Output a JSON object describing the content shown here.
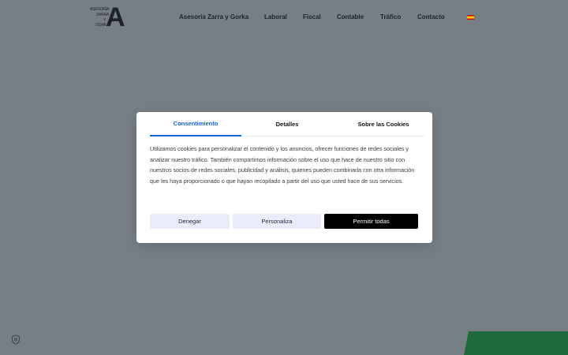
{
  "logo": {
    "small_lines": [
      "ASESORÍA",
      "ZARRA",
      "Y",
      "GORKA"
    ],
    "big_letter": "A"
  },
  "nav": {
    "items": [
      {
        "label": "Asesoría Zarra y Gorka"
      },
      {
        "label": "Laboral"
      },
      {
        "label": "Fiscal"
      },
      {
        "label": "Contable"
      },
      {
        "label": "Tráfico"
      },
      {
        "label": "Contacto"
      }
    ],
    "language_flag": "spain-flag-icon"
  },
  "cookie_modal": {
    "tabs": [
      {
        "label": "Consentimiento",
        "active": true
      },
      {
        "label": "Detalles",
        "active": false
      },
      {
        "label": "Sobre las Cookies",
        "active": false
      }
    ],
    "text": "Utilizamos cookies para personalizar el contenido y los anuncios, ofrecer funciones de redes sociales y analizar nuestro tráfico. También compartimos información sobre el uso que hace de nuestro sitio con nuestros socios de redes sociales, publicidad y análisis, quienes pueden combinarla con otra información que les haya proporcionado o que hayan recopilado a partir del uso que usted hace de sus servicios.",
    "buttons": {
      "deny": "Denegar",
      "customize": "Personaliza",
      "allow_all": "Permitir todas"
    }
  },
  "colors": {
    "overlay": "#767e86",
    "accent": "#1863dc",
    "green_band": "#1e6a3c"
  },
  "icons": {
    "cookie_settings": "shield-icon"
  }
}
